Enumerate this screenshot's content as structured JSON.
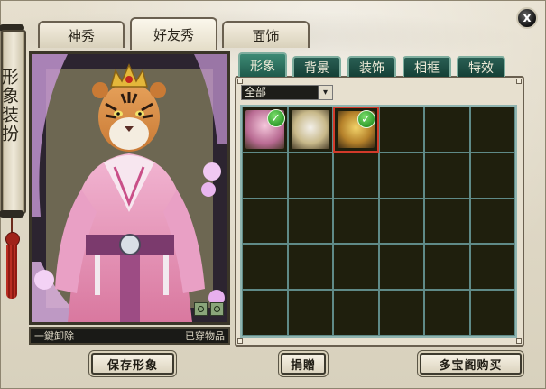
{
  "side_title": "形象装扮",
  "tabs": [
    {
      "label": "神秀",
      "active": false
    },
    {
      "label": "好友秀",
      "active": true
    },
    {
      "label": "面饰",
      "active": false
    }
  ],
  "close_label": "x",
  "preview": {
    "unequip_all_label": "一鍵卸除",
    "worn_items_label": "已穿物品"
  },
  "subtabs": [
    {
      "label": "形象",
      "active": true
    },
    {
      "label": "背景",
      "active": false
    },
    {
      "label": "装饰",
      "active": false
    },
    {
      "label": "相框",
      "active": false
    },
    {
      "label": "特效",
      "active": false
    }
  ],
  "filter": {
    "selected": "全部"
  },
  "inventory": {
    "columns": 6,
    "rows": 5,
    "items": [
      {
        "slot": 0,
        "icon": "pink-robe-outfit",
        "equipped": true,
        "selected": false
      },
      {
        "slot": 1,
        "icon": "white-winged-pet",
        "equipped": false,
        "selected": false
      },
      {
        "slot": 2,
        "icon": "golden-crown-headpiece",
        "equipped": true,
        "selected": true
      }
    ]
  },
  "buttons": {
    "save": "保存形象",
    "gift": "捐贈",
    "shop": "多宝阁购买"
  },
  "colors": {
    "accent_tab": "#2a6b5e",
    "selected_slot": "#d23a2a",
    "check": "#2e9a2a"
  }
}
